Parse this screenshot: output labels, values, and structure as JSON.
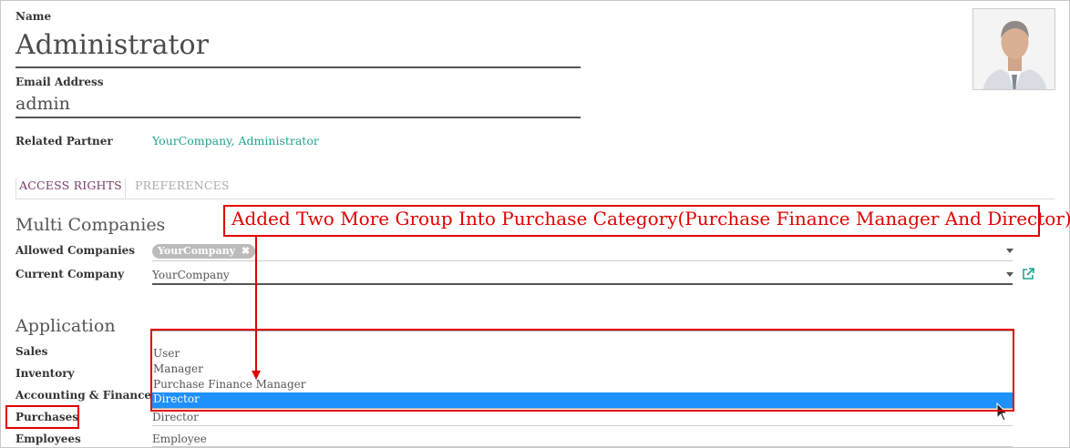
{
  "form": {
    "name_label": "Name",
    "name_value": "Administrator",
    "email_label": "Email Address",
    "email_value": "admin",
    "partner_label": "Related Partner",
    "partner_value": "YourCompany, Administrator"
  },
  "tabs": [
    {
      "label": "ACCESS RIGHTS",
      "active": true
    },
    {
      "label": "PREFERENCES",
      "active": false
    }
  ],
  "multi_companies": {
    "title": "Multi Companies",
    "allowed_label": "Allowed Companies",
    "allowed_tag": "YourCompany",
    "current_label": "Current Company",
    "current_value": "YourCompany"
  },
  "application": {
    "title": "Application",
    "rows": [
      {
        "label": "Sales",
        "value": ""
      },
      {
        "label": "Inventory",
        "value": ""
      },
      {
        "label": "Accounting & Finance",
        "value": ""
      },
      {
        "label": "Purchases",
        "value": "Director"
      },
      {
        "label": "Employees",
        "value": "Employee"
      }
    ]
  },
  "dropdown": {
    "options": [
      "User",
      "Manager",
      "Purchase Finance Manager",
      "Director"
    ],
    "selected": "Director"
  },
  "annotation": {
    "text": "Added Two More Group Into Purchase Category(Purchase Finance Manager And Director)"
  },
  "colors": {
    "annotation": "#e00000",
    "link": "#21a38e",
    "tab_active": "#7a3b6b",
    "selection": "#1e90ff"
  }
}
